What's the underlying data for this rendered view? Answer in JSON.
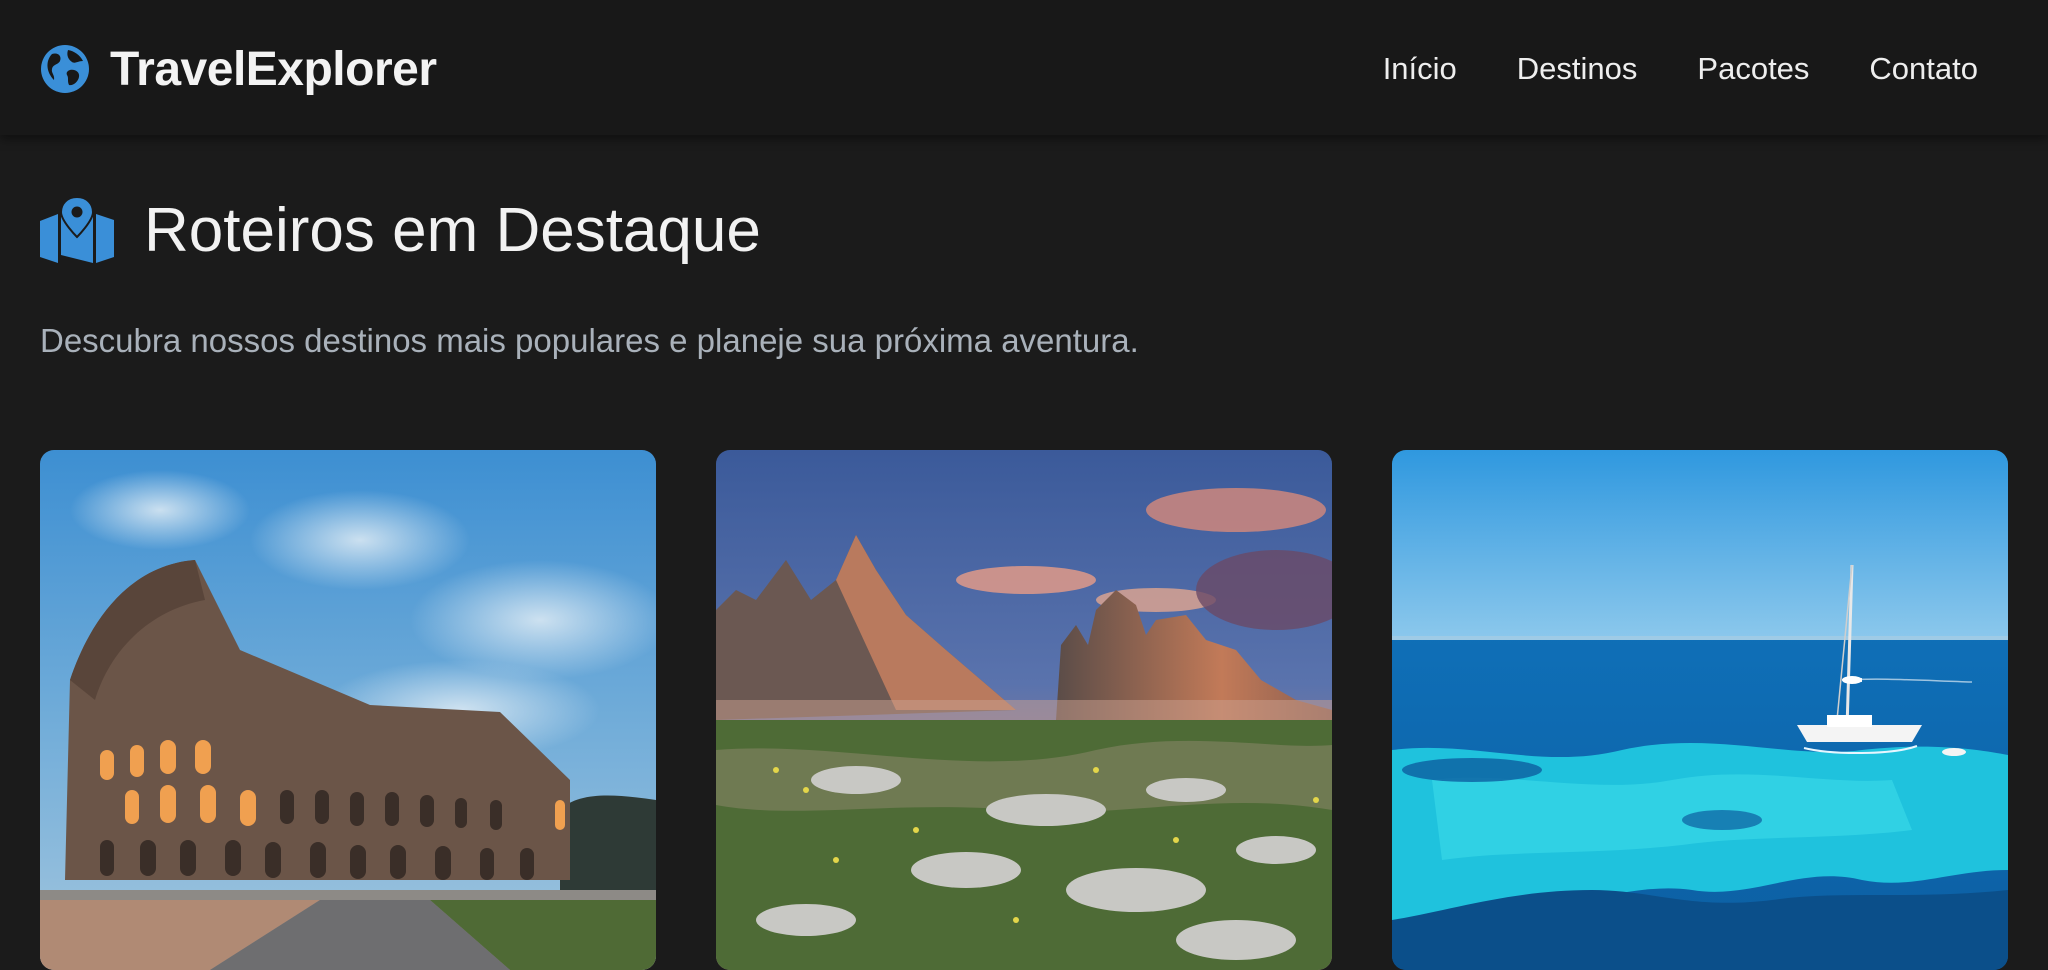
{
  "header": {
    "brand": "TravelExplorer",
    "brand_icon": "globe-icon",
    "accent_color": "#3a8fd8",
    "nav": [
      {
        "label": "Início"
      },
      {
        "label": "Destinos"
      },
      {
        "label": "Pacotes"
      },
      {
        "label": "Contato"
      }
    ]
  },
  "main": {
    "title": "Roteiros em Destaque",
    "title_icon": "map-marker-icon",
    "subtitle": "Descubra nossos destinos mais populares e planeje sua próxima aventura.",
    "cards": [
      {
        "image": "colosseum-photo"
      },
      {
        "image": "dolomites-mountains-photo"
      },
      {
        "image": "turquoise-sea-sailboat-photo"
      }
    ]
  }
}
